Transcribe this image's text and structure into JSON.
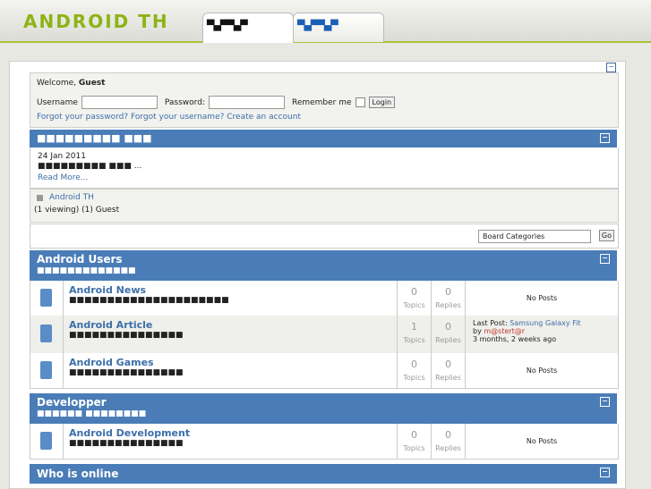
{
  "header": {
    "logo": "ANDROID TH",
    "tab1": "▀▄▀▀▄▀",
    "tab2": "▀▄▀▀▄▀"
  },
  "login": {
    "welcome": "Welcome,",
    "guest": "Guest",
    "username_label": "Username",
    "password_label": "Password:",
    "remember_label": "Remember me",
    "login_button": "Login",
    "forgot_pw": "Forgot your password?",
    "forgot_user": "Forgot your username?",
    "create": "Create an account"
  },
  "news": {
    "title": "■■■■■■■■■ ■■■",
    "date": "24 Jan 2011",
    "text": "■■■■■■■■■ ■■■ ...",
    "read_more": "Read More..."
  },
  "online": {
    "link": "Android TH",
    "text": "(1 viewing) (1) Guest"
  },
  "categories": {
    "select": "Board Categories",
    "go": "Go"
  },
  "sections": [
    {
      "title": "Android Users",
      "subtitle": "■■■■■■■■■■■■■"
    },
    {
      "title": "Developper",
      "subtitle": "■■■■■■ ■■■■■■■■"
    },
    {
      "title": "Who is online"
    }
  ],
  "boards": [
    {
      "name": "Android News",
      "desc": "■■■■■■■■■■■■■■■■■■■■■",
      "topics": "0",
      "replies": "0",
      "last": "No Posts"
    },
    {
      "name": "Android Article",
      "desc": "■■■■■■■■■■■■■■■",
      "topics": "1",
      "replies": "0",
      "last_prefix": "Last Post:",
      "last_title": "Samsung Galaxy Fit",
      "by": "by",
      "author": "m@stert@r",
      "ago": "3 months, 2 weeks ago"
    },
    {
      "name": "Android Games",
      "desc": "■■■■■■■■■■■■■■■",
      "topics": "0",
      "replies": "0",
      "last": "No Posts"
    },
    {
      "name": "Android Development",
      "desc": "■■■■■■■■■■■■■■■",
      "topics": "0",
      "replies": "0",
      "last": "No Posts"
    }
  ],
  "labels": {
    "topics": "Topics",
    "replies": "Replies"
  }
}
